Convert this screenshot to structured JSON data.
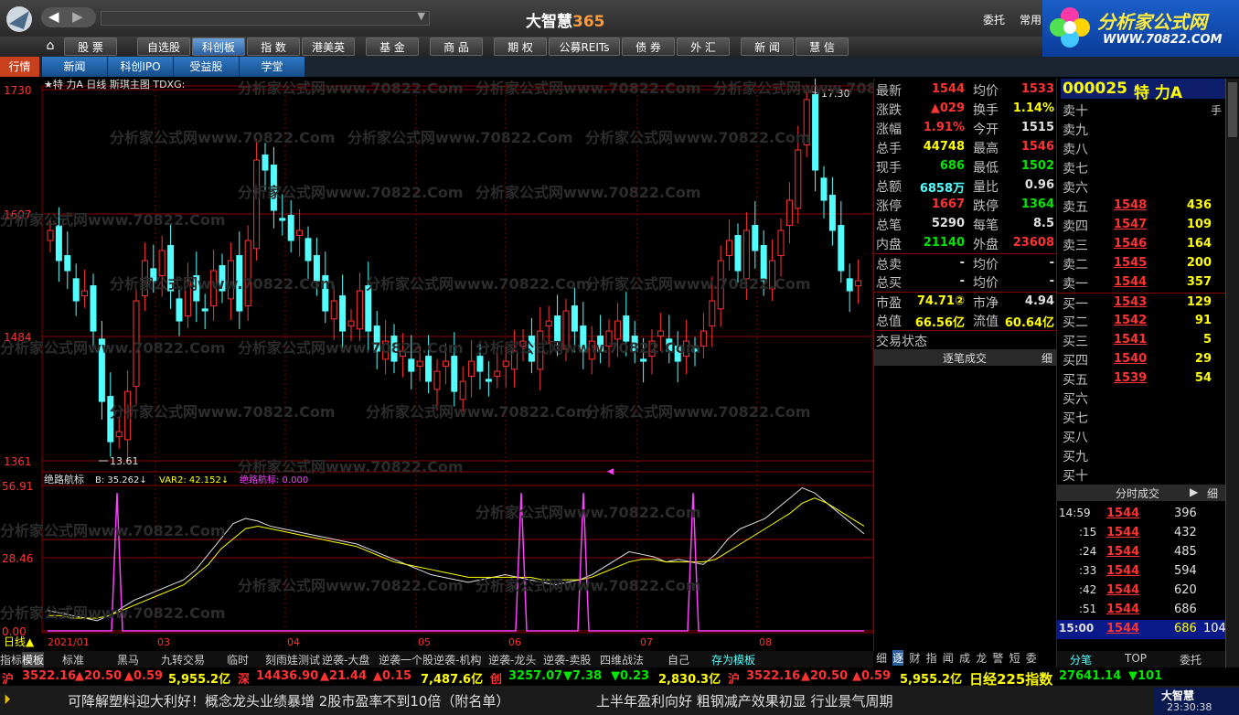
{
  "title": {
    "app": "大智慧",
    "app_num": "365",
    "entrust": "委托",
    "common": "常用",
    "logo_text": "分析家公式网",
    "logo_url": "WWW.70822.COM"
  },
  "nav": [
    "股 票",
    "自选股",
    "科创板",
    "指 数",
    "港美英",
    "基 金",
    "商 品",
    "期 权",
    "公募REITs",
    "债 券",
    "外 汇",
    "新 闻",
    "慧 信"
  ],
  "nav_active": 2,
  "subnav": [
    "行情",
    "新闻",
    "科创IPO",
    "受益股",
    "学堂"
  ],
  "chart_title": "★特 力A 日线 斯琪主图 TDXG:",
  "price_axis": [
    "1730",
    "1607",
    "1484",
    "1361"
  ],
  "ind_axis": [
    "56.91",
    "28.46",
    "0.00"
  ],
  "high_label": "17.30",
  "low_label": "13.61",
  "indicator_label": {
    "name": "绝路航标",
    "b": "B: 35.262↓",
    "var2": "VAR2: 42.152↓",
    "jlhb": "绝路航标: 0.000"
  },
  "date_axis": [
    "2021/01",
    "03",
    "04",
    "05",
    "06",
    "07",
    "08"
  ],
  "dayline": "日线▲",
  "chart_data": {
    "type": "candlestick",
    "title": "★特 力A 日线",
    "x_ticks": [
      "2021/01",
      "03",
      "04",
      "05",
      "06",
      "07",
      "08"
    ],
    "ylim": [
      13.61,
      17.3
    ],
    "y_ticks": [
      17.3,
      16.07,
      14.84,
      13.61
    ],
    "annotations": [
      "17.30",
      "13.61"
    ],
    "indicator": {
      "name": "绝路航标",
      "B": 35.262,
      "VAR2": 42.152,
      "绝路航标": 0.0,
      "ylim": [
        0,
        56.91
      ],
      "y_ticks": [
        56.91,
        28.46,
        0.0
      ]
    }
  },
  "quote": {
    "code": "000025",
    "name": "特 力A",
    "rows": [
      [
        "最新",
        "1544",
        "均价",
        "1533"
      ],
      [
        "涨跌",
        "▲029",
        "换手",
        "1.14%"
      ],
      [
        "涨幅",
        "1.91%",
        "今开",
        "1515"
      ],
      [
        "总手",
        "44748",
        "最高",
        "1546"
      ],
      [
        "现手",
        "686",
        "最低",
        "1502"
      ],
      [
        "总额",
        "6858万",
        "量比",
        "0.96"
      ],
      [
        "涨停",
        "1667",
        "跌停",
        "1364"
      ],
      [
        "总笔",
        "5290",
        "每笔",
        "8.5"
      ],
      [
        "内盘",
        "21140",
        "外盘",
        "23608"
      ],
      [
        "总卖",
        "-",
        "均价",
        "-"
      ],
      [
        "总买",
        "-",
        "均价",
        "-"
      ],
      [
        "市盈",
        "74.71②",
        "市净",
        "4.94"
      ],
      [
        "总值",
        "66.56亿",
        "流值",
        "60.64亿"
      ],
      [
        "交易状态",
        "",
        "",
        ""
      ]
    ],
    "tick_header": "逐笔成交",
    "tick_btn": "细",
    "tabs": [
      "细",
      "逐",
      "财",
      "指",
      "闻",
      "成",
      "龙",
      "警",
      "短",
      "委"
    ]
  },
  "book": {
    "hand": "手",
    "sell": [
      [
        "卖十",
        "",
        ""
      ],
      [
        "卖九",
        "",
        ""
      ],
      [
        "卖八",
        "",
        ""
      ],
      [
        "卖七",
        "",
        ""
      ],
      [
        "卖六",
        "",
        ""
      ],
      [
        "卖五",
        "1548",
        "436"
      ],
      [
        "卖四",
        "1547",
        "109"
      ],
      [
        "卖三",
        "1546",
        "164"
      ],
      [
        "卖二",
        "1545",
        "200"
      ],
      [
        "卖一",
        "1544",
        "357"
      ]
    ],
    "buy": [
      [
        "买一",
        "1543",
        "129"
      ],
      [
        "买二",
        "1542",
        "91"
      ],
      [
        "买三",
        "1541",
        "5"
      ],
      [
        "买四",
        "1540",
        "29"
      ],
      [
        "买五",
        "1539",
        "54"
      ],
      [
        "买六",
        "",
        ""
      ],
      [
        "买七",
        "",
        ""
      ],
      [
        "买八",
        "",
        ""
      ],
      [
        "买九",
        "",
        ""
      ],
      [
        "买十",
        "",
        ""
      ]
    ],
    "time_header": "分时成交",
    "time_btn": "细",
    "trades": [
      [
        "14:59",
        "1544",
        "396"
      ],
      [
        ":15",
        "1544",
        "432"
      ],
      [
        ":24",
        "1544",
        "485"
      ],
      [
        ":33",
        "1544",
        "594"
      ],
      [
        ":42",
        "1544",
        "620"
      ],
      [
        ":51",
        "1544",
        "686"
      ],
      [
        "15:00",
        "1544",
        "686",
        "104"
      ]
    ],
    "bottom_tabs": [
      "分笔",
      "TOP",
      "委托"
    ]
  },
  "bottom_tabs": [
    "指标",
    "模板",
    "标准",
    "黑马",
    "九转交易",
    "临时",
    "刻雨娃测试",
    "逆袭-大盘",
    "逆袭一个股",
    "逆袭-机构",
    "逆袭-龙头",
    "逆袭-卖股",
    "四维战法",
    "自己",
    "存为模板"
  ],
  "ticker1": [
    {
      "t": "沪",
      "c": "#ff3232"
    },
    {
      "t": "3522.16",
      "c": "#ff3232"
    },
    {
      "t": "▲20.50",
      "c": "#ff3232"
    },
    {
      "t": "▲0.59",
      "c": "#ff3232"
    },
    {
      "t": "5,955.2亿",
      "c": "#ffff00"
    },
    {
      "t": "深",
      "c": "#ff3232"
    },
    {
      "t": "14436.90",
      "c": "#ff3232"
    },
    {
      "t": "▲21.44",
      "c": "#ff3232"
    },
    {
      "t": "▲0.15",
      "c": "#ff3232"
    },
    {
      "t": "7,487.6亿",
      "c": "#ffff00"
    },
    {
      "t": "创",
      "c": "#ff3232"
    },
    {
      "t": "3257.07",
      "c": "#00e600"
    },
    {
      "t": "▼7.38",
      "c": "#00e600"
    },
    {
      "t": "▼0.23",
      "c": "#00e600"
    },
    {
      "t": "2,830.3亿",
      "c": "#ffff00"
    },
    {
      "t": "沪",
      "c": "#ff3232"
    },
    {
      "t": "3522.16",
      "c": "#ff3232"
    },
    {
      "t": "▲20.50",
      "c": "#ff3232"
    },
    {
      "t": "▲0.59",
      "c": "#ff3232"
    },
    {
      "t": "5,955.2亿",
      "c": "#ffff00"
    },
    {
      "t": "日经225指数",
      "c": "#ffff00"
    },
    {
      "t": "27641.14",
      "c": "#00e600"
    },
    {
      "t": "▼101",
      "c": "#00e600"
    }
  ],
  "ticker2": {
    "left": "可降解塑料迎大利好！概念龙头业绩暴增 2股市盈率不到10倍（附名单）",
    "right": "上半年盈利向好 粗钢减产效果初显 行业景气周期",
    "brand": "大智慧",
    "clock": "23:30:38"
  },
  "watermark": "分析家公式网www.70822.Com"
}
